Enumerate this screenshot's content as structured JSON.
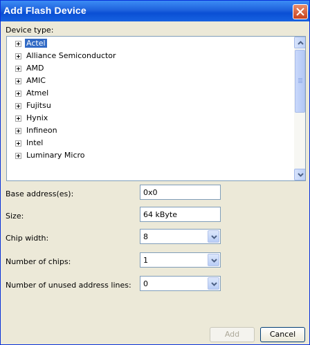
{
  "window": {
    "title": "Add Flash Device"
  },
  "device_type": {
    "label": "Device type:",
    "items": [
      {
        "label": "Actel",
        "selected": true
      },
      {
        "label": "Alliance Semiconductor"
      },
      {
        "label": "AMD"
      },
      {
        "label": "AMIC"
      },
      {
        "label": "Atmel"
      },
      {
        "label": "Fujitsu"
      },
      {
        "label": "Hynix"
      },
      {
        "label": "Infineon"
      },
      {
        "label": "Intel"
      },
      {
        "label": "Luminary Micro"
      }
    ]
  },
  "form": {
    "base_address": {
      "label": "Base address(es):",
      "value": "0x0"
    },
    "size": {
      "label": "Size:",
      "value": "64 kByte"
    },
    "chip_width": {
      "label": "Chip width:",
      "value": "8"
    },
    "num_chips": {
      "label": "Number of chips:",
      "value": "1"
    },
    "unused_lines": {
      "label": "Number of unused address lines:",
      "value": "0"
    }
  },
  "buttons": {
    "add": "Add",
    "cancel": "Cancel"
  },
  "colors": {
    "title_bar": "#0a4fd4",
    "selection": "#316ac5",
    "close": "#c9431f"
  }
}
